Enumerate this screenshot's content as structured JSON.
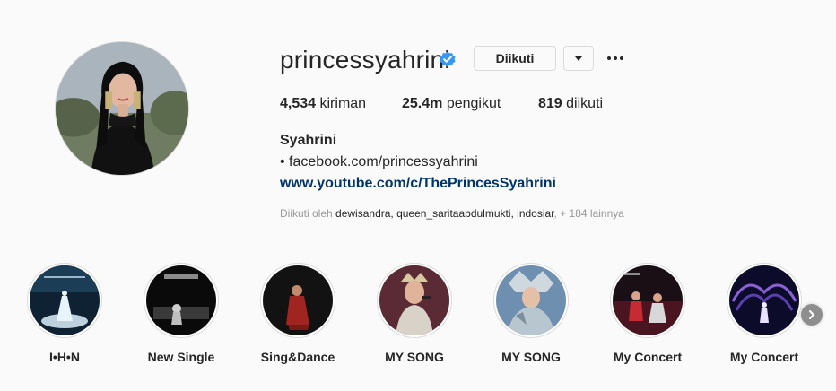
{
  "profile": {
    "username": "princessyahrini",
    "follow_label": "Diikuti",
    "stats": {
      "posts_count": "4,534",
      "posts_label": "kiriman",
      "followers_count": "25.4m",
      "followers_label": "pengikut",
      "following_count": "819",
      "following_label": "diikuti"
    },
    "full_name": "Syahrini",
    "bio_line": "• facebook.com/princessyahrini",
    "link": "www.youtube.com/c/ThePrincesSyahrini",
    "followed_by": {
      "prefix": "Diikuti oleh",
      "names": "dewisandra, queen_saritaabdulmukti, indosiar",
      "suffix": "+ 184 lainnya"
    }
  },
  "icons": {
    "verified": "verified-badge-icon",
    "dropdown": "triangle-down-icon",
    "more": "more-options-icon",
    "next": "chevron-right-icon"
  },
  "colors": {
    "verified_blue": "#3897f0",
    "link": "#003569",
    "muted": "#999999",
    "text": "#262626",
    "border": "#dbdbdb"
  },
  "highlights": [
    {
      "label": "I•H•N"
    },
    {
      "label": "New Single"
    },
    {
      "label": "Sing&Dance"
    },
    {
      "label": "MY SONG"
    },
    {
      "label": "MY SONG"
    },
    {
      "label": "My Concert"
    },
    {
      "label": "My Concert"
    }
  ]
}
